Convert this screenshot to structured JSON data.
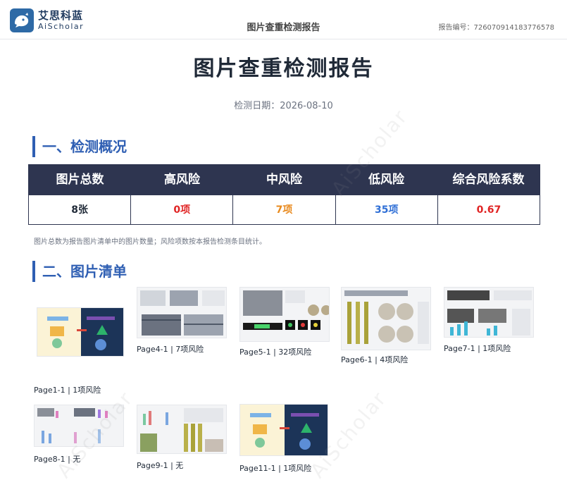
{
  "header": {
    "brand_cn": "艾思科蓝",
    "brand_en": "AiScholar",
    "title": "图片查重检测报告",
    "report_no_label": "报告编号：",
    "report_no": "726070914183776578"
  },
  "report": {
    "title": "图片查重检测报告",
    "date_label": "检测日期：",
    "date": "2026-08-10"
  },
  "section1": {
    "title": "一、检测概况",
    "headers": [
      "图片总数",
      "高风险",
      "中风险",
      "低风险",
      "综合风险系数"
    ],
    "values": [
      "8张",
      "0项",
      "7项",
      "35项",
      "0.67"
    ],
    "colors": [
      "#1f2937",
      "#e02424",
      "#e8891c",
      "#2f6fd6",
      "#e02424"
    ],
    "note": "图片总数为报告图片清单中的图片数量；风险项数按本报告检测条目统计。"
  },
  "section2": {
    "title": "二、图片清单",
    "items": [
      {
        "caption": "Page1-1 | 1项风险"
      },
      {
        "caption": "Page4-1 | 7项风险"
      },
      {
        "caption": "Page5-1 | 32项风险"
      },
      {
        "caption": "Page6-1 | 4项风险"
      },
      {
        "caption": "Page7-1 | 1项风险"
      },
      {
        "caption": "Page8-1 | 无"
      },
      {
        "caption": "Page9-1 | 无"
      },
      {
        "caption": "Page11-1 | 1项风险"
      }
    ]
  },
  "watermark_text": "AiScholar"
}
